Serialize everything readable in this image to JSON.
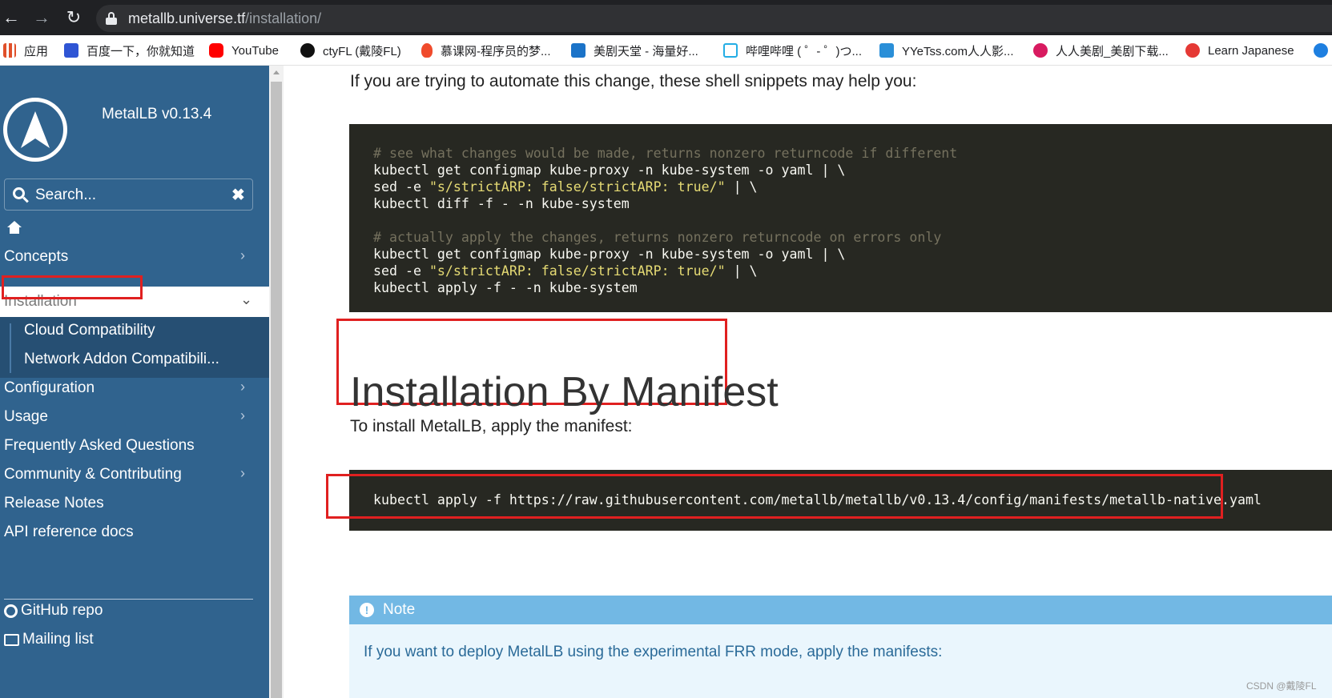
{
  "browser": {
    "url_host": "metallb.universe.tf",
    "url_path": "/installation/",
    "bookmarks": [
      {
        "label": "应用",
        "color": "#e0502a"
      },
      {
        "label": "百度一下，你就知道",
        "color": "#2f55d4"
      },
      {
        "label": "YouTube",
        "color": "#ff0000"
      },
      {
        "label": "ctyFL (戴陵FL)",
        "color": "#111111"
      },
      {
        "label": "慕课网-程序员的梦...",
        "color": "#f04b2c"
      },
      {
        "label": "美剧天堂 - 海量好...",
        "color": "#1b73c8"
      },
      {
        "label": "哔哩哔哩 ( ゜- ゜)つ...",
        "color": "#23ade5"
      },
      {
        "label": "YYeTss.com人人影...",
        "color": "#2a8fd8"
      },
      {
        "label": "人人美剧_美剧下载...",
        "color": "#d81b60"
      },
      {
        "label": "Learn Japanese",
        "color": "#e53935"
      }
    ]
  },
  "sidebar": {
    "version": "MetalLB v0.13.4",
    "search_placeholder": "Search...",
    "search_clear": "✖",
    "chevron": "›",
    "expanded_chevron": "⌄",
    "items": [
      {
        "label": "Concepts"
      },
      {
        "label": "Installation"
      },
      {
        "label": "Configuration"
      },
      {
        "label": "Usage"
      },
      {
        "label": "Frequently Asked Questions"
      },
      {
        "label": "Community & Contributing"
      },
      {
        "label": "Release Notes"
      },
      {
        "label": "API reference docs"
      }
    ],
    "subitems": [
      {
        "label": "Cloud Compatibility"
      },
      {
        "label": "Network Addon Compatibili..."
      }
    ],
    "links": [
      {
        "label": "GitHub repo"
      },
      {
        "label": "Mailing list"
      }
    ]
  },
  "content": {
    "intro": "If you are trying to automate this change, these shell snippets may help you:",
    "code1": [
      {
        "comment": "# see what changes would be made, returns nonzero returncode if different"
      },
      {
        "text": "kubectl get configmap kube-proxy -n kube-system -o yaml | \\"
      },
      {
        "pre": "sed -e ",
        "str": "\"s/strictARP: false/strictARP: true/\"",
        "post": " | \\"
      },
      {
        "text": "kubectl diff -f - -n kube-system"
      },
      {
        "text": ""
      },
      {
        "comment": "# actually apply the changes, returns nonzero returncode on errors only"
      },
      {
        "text": "kubectl get configmap kube-proxy -n kube-system -o yaml | \\"
      },
      {
        "pre": "sed -e ",
        "str": "\"s/strictARP: false/strictARP: true/\"",
        "post": " | \\"
      },
      {
        "text": "kubectl apply -f - -n kube-system"
      }
    ],
    "heading": "Installation By Manifest",
    "manifest_text": "To install MetalLB, apply the manifest:",
    "code2": "kubectl apply -f https://raw.githubusercontent.com/metallb/metallb/v0.13.4/config/manifests/metallb-native.yaml",
    "note_icon": "!",
    "note_title": "Note",
    "note_text": "If you want to deploy MetalLB using the experimental FRR mode, apply the manifests:"
  },
  "watermark": "CSDN @戴陵FL",
  "colors": {
    "sidebar": "#30638e",
    "highlight": "#e02020",
    "code_bg": "#272822",
    "note": "#72b8e4"
  }
}
